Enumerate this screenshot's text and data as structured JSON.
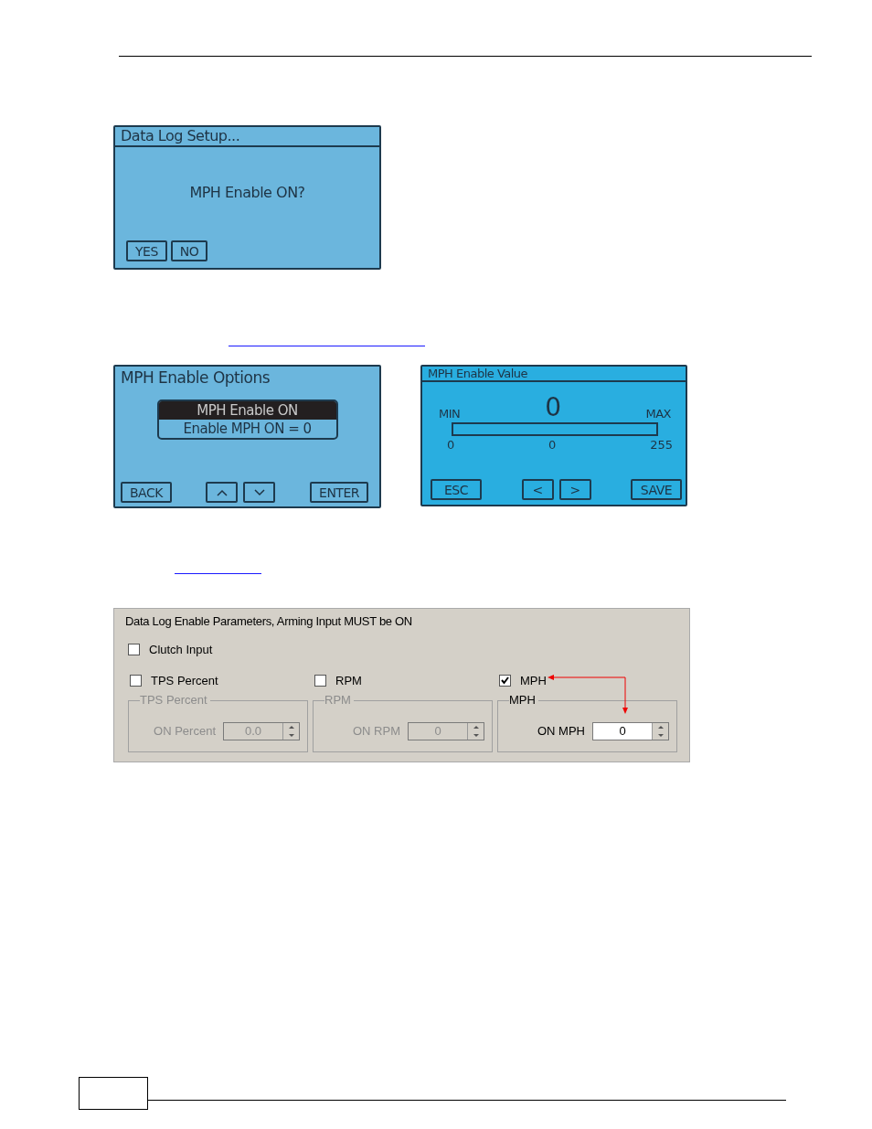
{
  "confirm_screen": {
    "title": "Data Log Setup...",
    "message": "MPH Enable ON?",
    "buttons": [
      "YES",
      "NO"
    ]
  },
  "options_screen": {
    "title": "MPH Enable Options",
    "items": [
      {
        "label": "MPH Enable ON",
        "selected": true
      },
      {
        "label": "Enable MPH ON = 0",
        "selected": false
      }
    ],
    "buttons": [
      {
        "kind": "text",
        "label": "BACK"
      },
      {
        "kind": "up"
      },
      {
        "kind": "down"
      },
      {
        "kind": "text",
        "label": "ENTER"
      }
    ]
  },
  "value_screen": {
    "title": "MPH Enable Value",
    "value": "0",
    "min_label": "MIN",
    "max_label": "MAX",
    "level": 0,
    "scale": [
      "0",
      "0",
      "255"
    ],
    "buttons": [
      "ESC",
      "<",
      ">",
      "SAVE"
    ]
  },
  "parameters": {
    "title": "Data Log Enable Parameters, Arming Input MUST be ON",
    "clutch": {
      "label": "Clutch Input",
      "checked": false
    },
    "groups": [
      {
        "check_label": "TPS Percent",
        "checked": false,
        "group_title": "TPS Percent",
        "field_label": "ON Percent",
        "value": "0.0",
        "annotated": false
      },
      {
        "check_label": "RPM",
        "checked": false,
        "group_title": "RPM",
        "field_label": "ON RPM",
        "value": "0",
        "annotated": false
      },
      {
        "check_label": "MPH",
        "checked": true,
        "group_title": "MPH",
        "field_label": "ON MPH",
        "value": "0",
        "annotated": true
      }
    ]
  }
}
